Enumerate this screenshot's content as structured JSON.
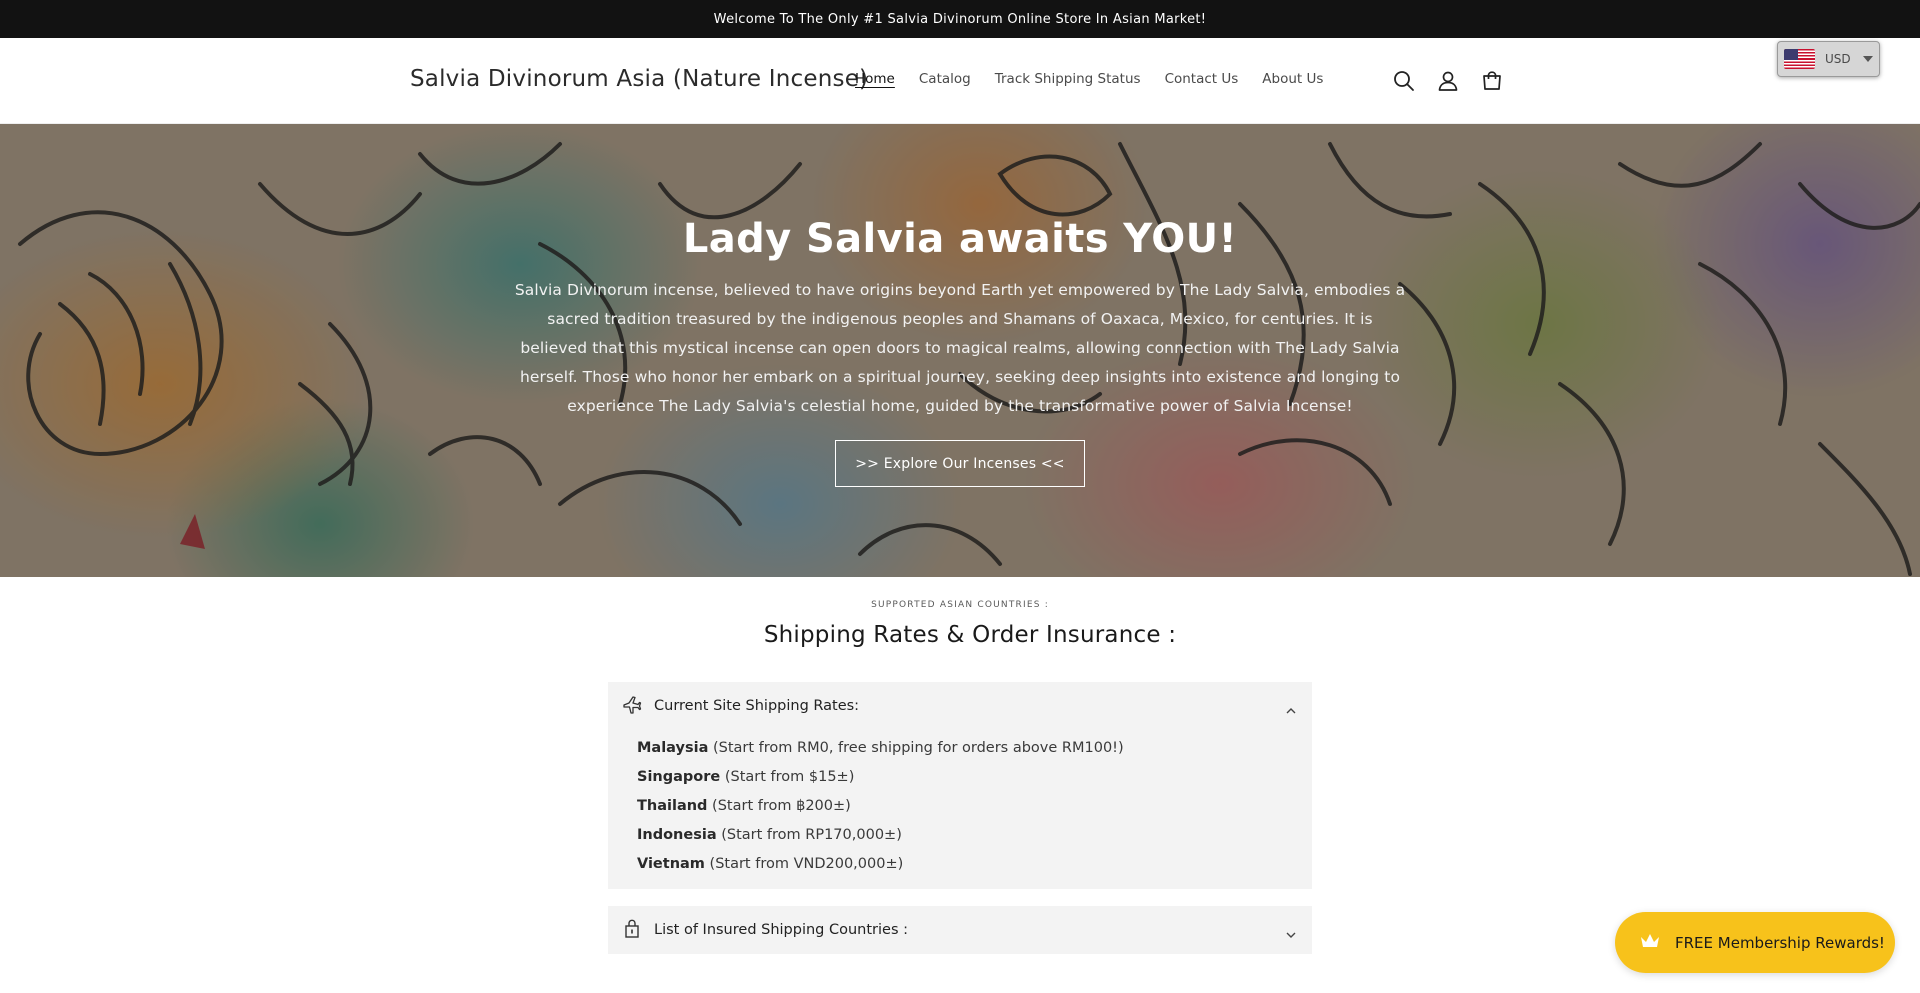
{
  "announcement": "Welcome To The Only #1 Salvia Divinorum Online Store In Asian Market!",
  "header": {
    "brand": "Salvia Divinorum Asia (Nature Incense)",
    "nav": [
      "Home",
      "Catalog",
      "Track Shipping Status",
      "Contact Us",
      "About Us"
    ],
    "active_nav": "Home",
    "icons": [
      "search-icon",
      "account-icon",
      "cart-icon"
    ]
  },
  "currency": {
    "code": "USD",
    "flag": "us-flag-icon"
  },
  "hero": {
    "title": "Lady Salvia awaits YOU!",
    "text": "Salvia Divinorum incense, believed to have origins beyond Earth yet empowered by The Lady Salvia, embodies a sacred tradition treasured by the indigenous peoples and Shamans of Oaxaca, Mexico, for centuries. It is believed that this mystical incense can open doors to magical realms, allowing connection with The Lady Salvia herself. Those who honor her embark on a spiritual journey, seeking deep insights into existence and longing to experience The Lady Salvia's celestial home, guided by the transformative power of Salvia Incense!",
    "button": ">> Explore Our Incenses <<"
  },
  "shipping": {
    "caption": "SUPPORTED ASIAN COUNTRIES :",
    "title": "Shipping Rates & Order Insurance :",
    "accordions": [
      {
        "title": "Current Site Shipping Rates:",
        "icon": "airplane-icon",
        "expanded": true,
        "rows": [
          {
            "country": "Malaysia",
            "detail": " (Start from RM0, free shipping for orders above RM100!)"
          },
          {
            "country": "Singapore",
            "detail": " (Start from $15±)"
          },
          {
            "country": "Thailand",
            "detail": " (Start from ฿200±)"
          },
          {
            "country": "Indonesia",
            "detail": " (Start from RP170,000±)"
          },
          {
            "country": "Vietnam",
            "detail": " (Start from VND200,000±)"
          }
        ]
      },
      {
        "title": "List of Insured Shipping Countries :",
        "icon": "lock-icon",
        "expanded": false
      }
    ]
  },
  "rewards": {
    "label": "FREE Membership Rewards!",
    "icon": "crown-icon",
    "color": "#f7c21b"
  }
}
